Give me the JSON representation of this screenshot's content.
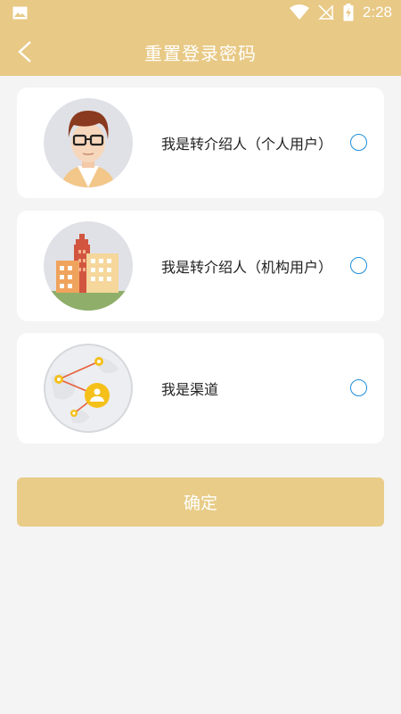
{
  "status_bar": {
    "time": "2:28",
    "icons": [
      "image-icon",
      "wifi-icon",
      "no-signal-icon",
      "battery-charging-icon"
    ]
  },
  "header": {
    "title": "重置登录密码",
    "back_icon": "back-chevron-icon"
  },
  "options": [
    {
      "label": "我是转介绍人（个人用户）",
      "icon": "person-avatar-icon",
      "selected": false
    },
    {
      "label": "我是转介绍人（机构用户）",
      "icon": "buildings-icon",
      "selected": false
    },
    {
      "label": "我是渠道",
      "icon": "channel-network-icon",
      "selected": false
    }
  ],
  "confirm_button": {
    "label": "确定"
  },
  "colors": {
    "accent": "#e8c985",
    "radio": "#1f8ed8",
    "background": "#f4f4f4"
  }
}
